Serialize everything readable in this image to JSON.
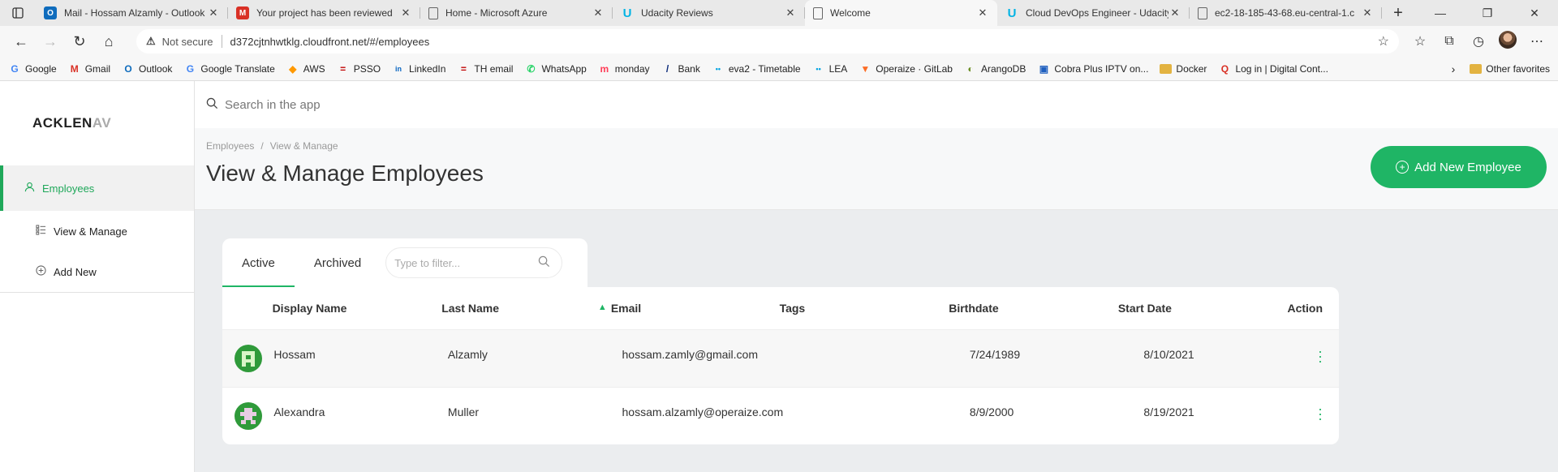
{
  "browser": {
    "tabs": [
      {
        "title": "Mail - Hossam Alzamly - Outlook",
        "icon": "outlook-icon",
        "color": "#0f6cbd",
        "glyph": "O"
      },
      {
        "title": "Your project has been reviewed",
        "icon": "gmail-icon",
        "color": "#d93025",
        "glyph": "M"
      },
      {
        "title": "Home - Microsoft Azure",
        "icon": "page-icon",
        "color": "#666666",
        "glyph": "▯"
      },
      {
        "title": "Udacity Reviews",
        "icon": "udacity-icon",
        "color": "#02b3e4",
        "glyph": "U"
      },
      {
        "title": "Welcome",
        "icon": "page-icon",
        "color": "#666666",
        "glyph": "▯",
        "active": true
      },
      {
        "title": "Cloud DevOps Engineer - Udacity",
        "icon": "udacity-icon",
        "color": "#02b3e4",
        "glyph": "U"
      },
      {
        "title": "ec2-18-185-43-68.eu-central-1.c",
        "icon": "page-icon",
        "color": "#666666",
        "glyph": "▯"
      }
    ],
    "address": {
      "security": "Not secure",
      "url": "d372cjtnhwtklg.cloudfront.net/#/employees"
    },
    "bookmarks": [
      {
        "label": "Google",
        "color": "#4285f4",
        "glyph": "G"
      },
      {
        "label": "Gmail",
        "color": "#d93025",
        "glyph": "M"
      },
      {
        "label": "Outlook",
        "color": "#0f6cbd",
        "glyph": "O"
      },
      {
        "label": "Google Translate",
        "color": "#4285f4",
        "glyph": "G"
      },
      {
        "label": "AWS",
        "color": "#ff9900",
        "glyph": "◆"
      },
      {
        "label": "PSSO",
        "color": "#c00000",
        "glyph": "="
      },
      {
        "label": "LinkedIn",
        "color": "#0a66c2",
        "glyph": "in"
      },
      {
        "label": "TH email",
        "color": "#c00000",
        "glyph": "="
      },
      {
        "label": "WhatsApp",
        "color": "#25d366",
        "glyph": "✆"
      },
      {
        "label": "monday",
        "color": "#ff3d57",
        "glyph": "m"
      },
      {
        "label": "Bank",
        "color": "#0b2a7a",
        "glyph": "/"
      },
      {
        "label": "eva2 - Timetable",
        "color": "#00a3e0",
        "glyph": "••"
      },
      {
        "label": "LEA",
        "color": "#00a3e0",
        "glyph": "••"
      },
      {
        "label": "Operaize · GitLab",
        "color": "#fc6d26",
        "glyph": "▼"
      },
      {
        "label": "ArangoDB",
        "color": "#6b8e23",
        "glyph": "◐"
      },
      {
        "label": "Cobra Plus IPTV on...",
        "color": "#1f5fbf",
        "glyph": "▣"
      },
      {
        "label": "Docker",
        "color": "#e3b341",
        "glyph": "",
        "folder": true
      },
      {
        "label": "Log in | Digital Cont...",
        "color": "#d93025",
        "glyph": "Q"
      }
    ],
    "other_favorites": "Other favorites"
  },
  "app": {
    "logo_main": "ACKLEN",
    "logo_fade": "AV",
    "search_placeholder": "Search in the app",
    "sidebar": {
      "section": "Employees",
      "items": [
        {
          "label": "View & Manage"
        },
        {
          "label": "Add New"
        }
      ]
    },
    "breadcrumb": {
      "root": "Employees",
      "current": "View & Manage"
    },
    "page_title": "View & Manage Employees",
    "add_button": "Add New Employee",
    "tabs": {
      "active": "Active",
      "archived": "Archived"
    },
    "filter_placeholder": "Type to filter...",
    "table": {
      "headers": {
        "display_name": "Display Name",
        "last_name": "Last Name",
        "email": "Email",
        "tags": "Tags",
        "birthdate": "Birthdate",
        "start_date": "Start Date",
        "action": "Action"
      },
      "rows": [
        {
          "display_name": "Hossam",
          "last_name": "Alzamly",
          "email": "hossam.zamly@gmail.com",
          "tags": "",
          "birthdate": "7/24/1989",
          "start_date": "8/10/2021"
        },
        {
          "display_name": "Alexandra",
          "last_name": "Muller",
          "email": "hossam.alzamly@operaize.com",
          "tags": "",
          "birthdate": "8/9/2000",
          "start_date": "8/19/2021"
        }
      ]
    },
    "accent_color": "#1fb565"
  }
}
